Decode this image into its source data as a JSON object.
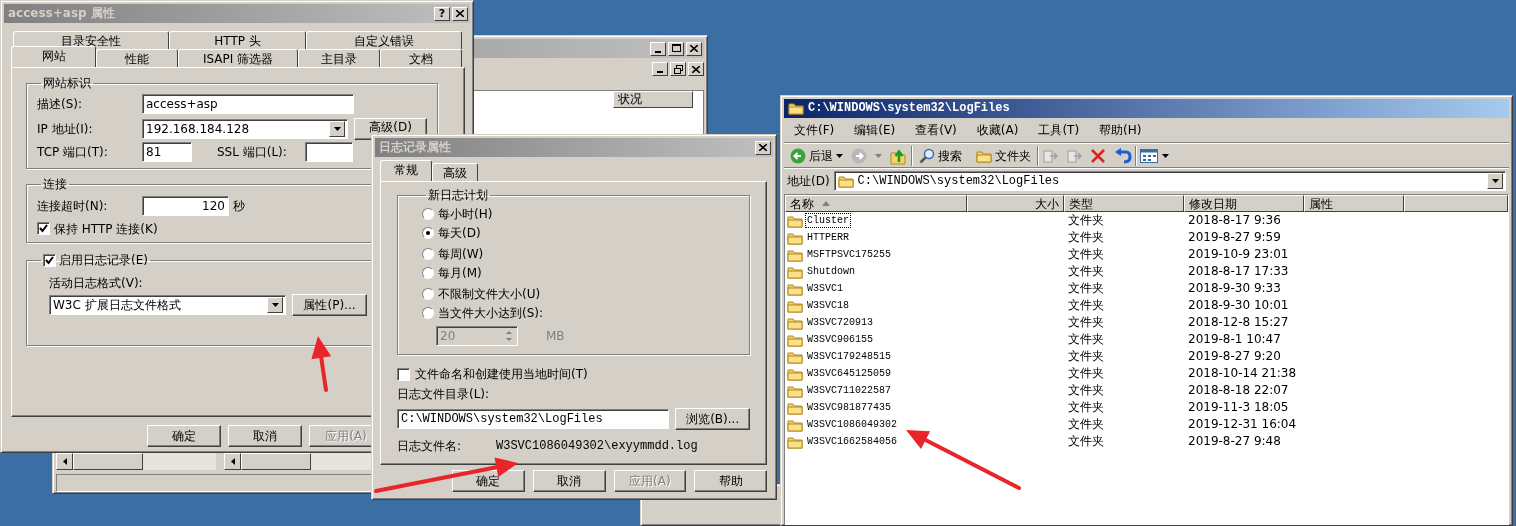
{
  "background_window": {
    "column_header": "状况"
  },
  "site_dialog": {
    "title": "access+asp 属性",
    "help_button": "?",
    "tabs_row1": [
      {
        "label": "目录安全性",
        "selected": false
      },
      {
        "label": "HTTP 头",
        "selected": false
      },
      {
        "label": "自定义错误",
        "selected": false
      }
    ],
    "tabs_row2": [
      {
        "label": "网站",
        "selected": true
      },
      {
        "label": "性能",
        "selected": false
      },
      {
        "label": "ISAPI 筛选器",
        "selected": false
      },
      {
        "label": "主目录",
        "selected": false
      },
      {
        "label": "文档",
        "selected": false
      }
    ],
    "identity": {
      "title": "网站标识",
      "description_label": "描述(S):",
      "description": "access+asp",
      "ip_label": "IP 地址(I):",
      "ip": "192.168.184.128",
      "advanced_button": "高级(D)",
      "tcp_label": "TCP 端口(T):",
      "tcp_port": "81",
      "ssl_label": "SSL 端口(L):"
    },
    "connection": {
      "title": "连接",
      "timeout_label": "连接超时(N):",
      "timeout": "120",
      "timeout_unit": "秒",
      "keep_alive": {
        "label": "保持 HTTP 连接(K)",
        "checked": true
      }
    },
    "logging": {
      "enable": {
        "label": "启用日志记录(E)",
        "checked": true
      },
      "format_label": "活动日志格式(V):",
      "format": "W3C 扩展日志文件格式",
      "properties_button": "属性(P)..."
    },
    "buttons": [
      {
        "label": "确定",
        "disabled": false
      },
      {
        "label": "取消",
        "disabled": false
      },
      {
        "label": "应用(A)",
        "disabled": true
      }
    ]
  },
  "log_dialog": {
    "title": "日志记录属性",
    "tabs": [
      {
        "label": "常规",
        "selected": true
      },
      {
        "label": "高级",
        "selected": false
      }
    ],
    "schedule": {
      "title": "新日志计划",
      "options": [
        {
          "label": "每小时(H)",
          "selected": false
        },
        {
          "label": "每天(D)",
          "selected": true
        },
        {
          "label": "每周(W)",
          "selected": false
        },
        {
          "label": "每月(M)",
          "selected": false
        },
        {
          "label": "不限制文件大小(U)",
          "selected": false
        },
        {
          "label": "当文件大小达到(S):",
          "selected": false
        }
      ],
      "size": "20",
      "size_unit": "MB"
    },
    "local_time": {
      "label": "文件命名和创建使用当地时间(T)",
      "checked": false
    },
    "directory_label": "日志文件目录(L):",
    "directory": "C:\\WINDOWS\\system32\\LogFiles",
    "browse_button": "浏览(B)...",
    "file_name_label": "日志文件名:",
    "file_name": "W3SVC1086049302\\exyymmdd.log",
    "buttons": [
      {
        "label": "确定",
        "disabled": false
      },
      {
        "label": "取消",
        "disabled": false
      },
      {
        "label": "应用(A)",
        "disabled": true
      },
      {
        "label": "帮助",
        "disabled": false
      }
    ]
  },
  "explorer": {
    "title": "C:\\WINDOWS\\system32\\LogFiles",
    "menu": [
      "文件(F)",
      "编辑(E)",
      "查看(V)",
      "收藏(A)",
      "工具(T)",
      "帮助(H)"
    ],
    "toolbar": {
      "back": "后退",
      "search": "搜索",
      "folders": "文件夹"
    },
    "address_label": "地址(D)",
    "address": "C:\\WINDOWS\\system32\\LogFiles",
    "columns": [
      {
        "label": "名称",
        "sorted": true
      },
      {
        "label": "大小",
        "sorted": false
      },
      {
        "label": "类型",
        "sorted": false
      },
      {
        "label": "修改日期",
        "sorted": false
      },
      {
        "label": "属性",
        "sorted": false
      }
    ],
    "rows": [
      {
        "name": "Cluster",
        "type": "文件夹",
        "modified": "2018-8-17 9:36",
        "focused": true
      },
      {
        "name": "HTTPERR",
        "type": "文件夹",
        "modified": "2019-8-27 9:59",
        "focused": false
      },
      {
        "name": "MSFTPSVC175255",
        "type": "文件夹",
        "modified": "2019-10-9 23:01",
        "focused": false
      },
      {
        "name": "Shutdown",
        "type": "文件夹",
        "modified": "2018-8-17 17:33",
        "focused": false
      },
      {
        "name": "W3SVC1",
        "type": "文件夹",
        "modified": "2018-9-30 9:33",
        "focused": false
      },
      {
        "name": "W3SVC18",
        "type": "文件夹",
        "modified": "2018-9-30 10:01",
        "focused": false
      },
      {
        "name": "W3SVC720913",
        "type": "文件夹",
        "modified": "2018-12-8 15:27",
        "focused": false
      },
      {
        "name": "W3SVC906155",
        "type": "文件夹",
        "modified": "2019-8-1 10:47",
        "focused": false
      },
      {
        "name": "W3SVC179248515",
        "type": "文件夹",
        "modified": "2019-8-27 9:20",
        "focused": false
      },
      {
        "name": "W3SVC645125059",
        "type": "文件夹",
        "modified": "2018-10-14 21:38",
        "focused": false
      },
      {
        "name": "W3SVC711022587",
        "type": "文件夹",
        "modified": "2018-8-18 22:07",
        "focused": false
      },
      {
        "name": "W3SVC981877435",
        "type": "文件夹",
        "modified": "2019-11-3 18:05",
        "focused": false
      },
      {
        "name": "W3SVC1086049302",
        "type": "文件夹",
        "modified": "2019-12-31 16:04",
        "focused": false
      },
      {
        "name": "W3SVC1662584056",
        "type": "文件夹",
        "modified": "2019-8-27 9:48",
        "focused": false
      }
    ]
  }
}
